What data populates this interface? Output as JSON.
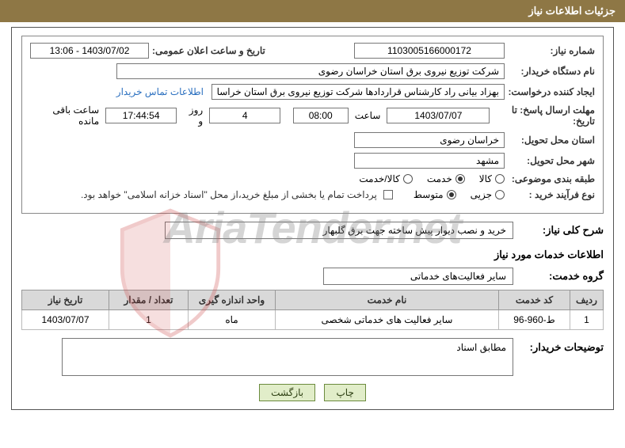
{
  "header": {
    "title": "جزئیات اطلاعات نیاز"
  },
  "fields": {
    "need_number_label": "شماره نیاز:",
    "need_number_value": "1103005166000172",
    "announce_label": "تاریخ و ساعت اعلان عمومی:",
    "announce_value": "1403/07/02 - 13:06",
    "buyer_org_label": "نام دستگاه خریدار:",
    "buyer_org_value": "شرکت توزیع نیروی برق استان خراسان رضوی",
    "request_creator_label": "ایجاد کننده درخواست:",
    "request_creator_value": "بهزاد بیانی راد کارشناس قراردادها شرکت توزیع نیروی برق استان خراسان رضوی",
    "contact_link": "اطلاعات تماس خریدار",
    "deadline_label": "مهلت ارسال پاسخ: تا تاریخ:",
    "deadline_date": "1403/07/07",
    "deadline_time_label": "ساعت",
    "deadline_time": "08:00",
    "days_remain": "4",
    "days_remain_label": "روز و",
    "time_remain": "17:44:54",
    "time_remain_label": "ساعت باقی مانده",
    "delivery_province_label": "استان محل تحویل:",
    "delivery_province_value": "خراسان رضوی",
    "delivery_city_label": "شهر محل تحویل:",
    "delivery_city_value": "مشهد",
    "category_label": "طبقه بندی موضوعی:",
    "category_opts": {
      "goods": "کالا",
      "service": "خدمت",
      "both": "کالا/خدمت"
    },
    "process_label": "نوع فرآیند خرید :",
    "process_opts": {
      "partial": "جزیی",
      "medium": "متوسط"
    },
    "payment_note": "پرداخت تمام یا بخشی از مبلغ خرید،از محل \"اسناد خزانه اسلامی\" خواهد بود."
  },
  "need_desc": {
    "label": "شرح کلی نیاز:",
    "value": "خرید و نصب دیوار پیش ساخته جهت برق گلبهار"
  },
  "services": {
    "title": "اطلاعات خدمات مورد نیاز",
    "group_label": "گروه خدمت:",
    "group_value": "سایر فعالیت‌های خدماتی"
  },
  "table": {
    "headers": [
      "ردیف",
      "کد خدمت",
      "نام خدمت",
      "واحد اندازه گیری",
      "تعداد / مقدار",
      "تاریخ نیاز"
    ],
    "rows": [
      {
        "r": "1",
        "code": "ط-960-96",
        "name": "سایر فعالیت های خدماتی شخصی",
        "unit": "ماه",
        "qty": "1",
        "date": "1403/07/07"
      }
    ]
  },
  "notes": {
    "buyer_notes_label": "توضیحات خریدار:",
    "buyer_notes_value": "مطابق اسناد"
  },
  "buttons": {
    "print": "چاپ",
    "back": "بازگشت"
  },
  "watermark": "AriaTender.net"
}
